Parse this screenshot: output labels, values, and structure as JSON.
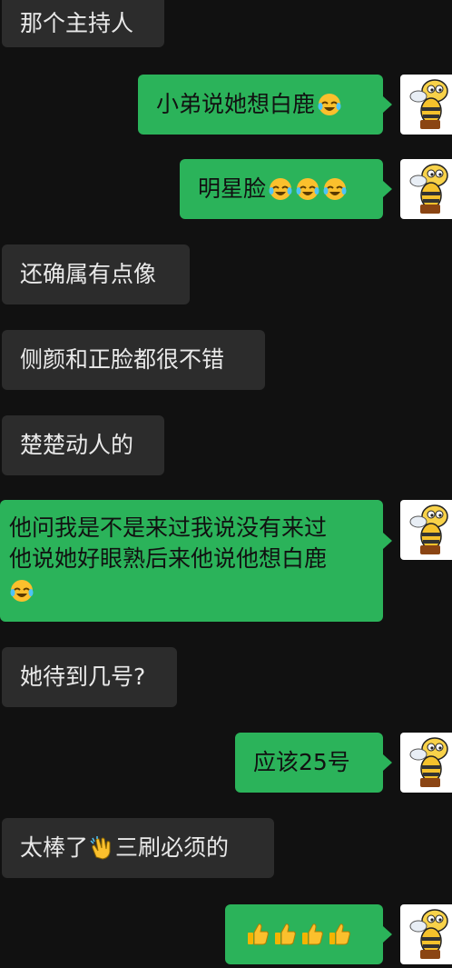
{
  "messages": [
    {
      "side": "left",
      "text": "那个主持人"
    },
    {
      "side": "right",
      "text": "小弟说她想白鹿",
      "emoji": [
        "laugh-cry"
      ]
    },
    {
      "side": "right",
      "text": "明星脸",
      "emoji": [
        "laugh-cry",
        "laugh-cry",
        "laugh-cry"
      ]
    },
    {
      "side": "left",
      "text": "还确属有点像"
    },
    {
      "side": "left",
      "text": "侧颜和正脸都很不错"
    },
    {
      "side": "left",
      "text": "楚楚动人的"
    },
    {
      "side": "right",
      "lines": [
        "他问我是不是来过我说没有来过",
        "他说她好眼熟后来他说他想白鹿"
      ],
      "emoji": [
        "laugh-cry"
      ]
    },
    {
      "side": "left",
      "text": "她待到几号?"
    },
    {
      "side": "right",
      "text": "应该25号"
    },
    {
      "side": "left",
      "text_before": "太棒了",
      "text_after": "三刷必须的",
      "emoji": [
        "clap"
      ]
    },
    {
      "side": "right",
      "text": "",
      "emoji": [
        "thumbs-up",
        "thumbs-up",
        "thumbs-up",
        "thumbs-up"
      ]
    }
  ],
  "colors": {
    "background": "#111111",
    "left_bubble": "#2c2c2c",
    "right_bubble": "#2bb35a",
    "left_text": "#e9e9e9",
    "right_text": "#111111"
  },
  "avatar_icon": "bee-mascot-icon"
}
